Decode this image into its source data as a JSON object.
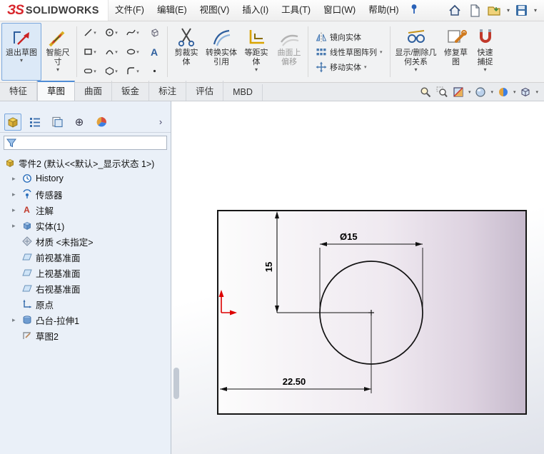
{
  "icons": {
    "caret": "▾",
    "chevron_right": "›",
    "expand_arrow": "▸",
    "annotation_a": "A",
    "dimxpert": "⊕"
  },
  "colors": {
    "accent_blue": "#4f8cd6",
    "face_purple": "#c6bacc",
    "origin_red": "#dd0000"
  },
  "menubar": {
    "logo_glyph": "ЗS",
    "logo_text": "SOLIDWORKS",
    "items": [
      {
        "label": "文件(F)"
      },
      {
        "label": "编辑(E)"
      },
      {
        "label": "视图(V)"
      },
      {
        "label": "插入(I)"
      },
      {
        "label": "工具(T)"
      },
      {
        "label": "窗口(W)"
      },
      {
        "label": "帮助(H)"
      }
    ]
  },
  "toolbar": {
    "exit_sketch": "退出草图",
    "smart_dimension": "智能尺寸",
    "trim_entities": "剪裁实体",
    "convert_entities": "转换实体引用",
    "offset_entities": "等距实体",
    "surface_offset": "曲面上偏移",
    "mirror_entities": "镜向实体",
    "linear_pattern": "线性草图阵列",
    "move_entities": "移动实体",
    "display_delete_relations": "显示/删除几何关系",
    "repair_sketch": "修复草图",
    "quick_snaps": "快速捕捉"
  },
  "ribbon_tabs": [
    {
      "label": "特征"
    },
    {
      "label": "草图"
    },
    {
      "label": "曲面"
    },
    {
      "label": "钣金"
    },
    {
      "label": "标注"
    },
    {
      "label": "评估"
    },
    {
      "label": "MBD"
    }
  ],
  "feature_tree": {
    "root_label": "零件2 (默认<<默认>_显示状态 1>)",
    "items": [
      {
        "label": "History"
      },
      {
        "label": "传感器"
      },
      {
        "label": "注解"
      },
      {
        "label": "实体(1)"
      },
      {
        "label": "材质 <未指定>"
      },
      {
        "label": "前视基准面"
      },
      {
        "label": "上视基准面"
      },
      {
        "label": "右视基准面"
      },
      {
        "label": "原点"
      },
      {
        "label": "凸台-拉伸1"
      },
      {
        "label": "草图2"
      }
    ]
  },
  "sketch": {
    "diameter_dim": "Ø15",
    "vertical_dim": "15",
    "horizontal_dim": "22.50"
  }
}
